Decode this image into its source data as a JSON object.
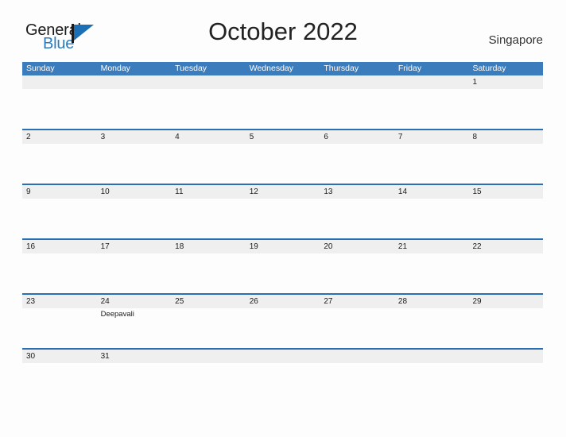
{
  "brand": {
    "name_part1": "General",
    "name_part2": "Blue",
    "flag_icon": "general-blue-flag-icon",
    "accent_color": "#1b6fb5"
  },
  "header": {
    "title": "October 2022",
    "location": "Singapore"
  },
  "colors": {
    "header_blue": "#3b7cbd",
    "row_divider_blue": "#2a6fb0",
    "date_band_gray": "#efefef",
    "page_background": "#fdfdfd",
    "text": "#1c1c1c"
  },
  "calendar": {
    "month": "October",
    "year": "2022",
    "weekday_headers": [
      "Sunday",
      "Monday",
      "Tuesday",
      "Wednesday",
      "Thursday",
      "Friday",
      "Saturday"
    ],
    "weeks": [
      {
        "dates": [
          "",
          "",
          "",
          "",
          "",
          "",
          "1"
        ],
        "events": [
          "",
          "",
          "",
          "",
          "",
          "",
          ""
        ]
      },
      {
        "dates": [
          "2",
          "3",
          "4",
          "5",
          "6",
          "7",
          "8"
        ],
        "events": [
          "",
          "",
          "",
          "",
          "",
          "",
          ""
        ]
      },
      {
        "dates": [
          "9",
          "10",
          "11",
          "12",
          "13",
          "14",
          "15"
        ],
        "events": [
          "",
          "",
          "",
          "",
          "",
          "",
          ""
        ]
      },
      {
        "dates": [
          "16",
          "17",
          "18",
          "19",
          "20",
          "21",
          "22"
        ],
        "events": [
          "",
          "",
          "",
          "",
          "",
          "",
          ""
        ]
      },
      {
        "dates": [
          "23",
          "24",
          "25",
          "26",
          "27",
          "28",
          "29"
        ],
        "events": [
          "",
          "Deepavali",
          "",
          "",
          "",
          "",
          ""
        ]
      },
      {
        "dates": [
          "30",
          "31",
          "",
          "",
          "",
          "",
          ""
        ],
        "events": [
          "",
          "",
          "",
          "",
          "",
          "",
          ""
        ]
      }
    ]
  }
}
